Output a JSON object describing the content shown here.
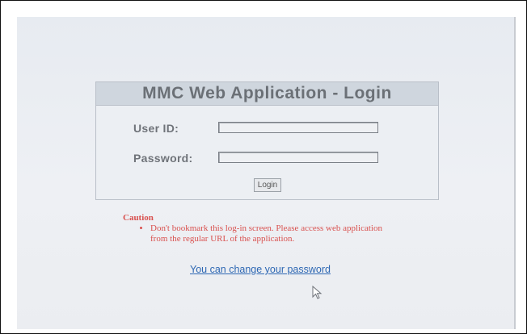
{
  "login": {
    "title": "MMC Web Application - Login",
    "user_id_label": "User ID:",
    "user_id_value": "",
    "password_label": "Password:",
    "password_value": "",
    "button_label": "Login"
  },
  "caution": {
    "title": "Caution",
    "message": "Don't bookmark this log-in screen. Please access web application from the regular URL of the application."
  },
  "links": {
    "change_password": "You can change your password"
  },
  "colors": {
    "caution_red": "#d9514f",
    "link_blue": "#2d67b3",
    "header_bg": "#cfd6de"
  },
  "icons": {
    "cursor": "mouse-pointer-icon"
  }
}
